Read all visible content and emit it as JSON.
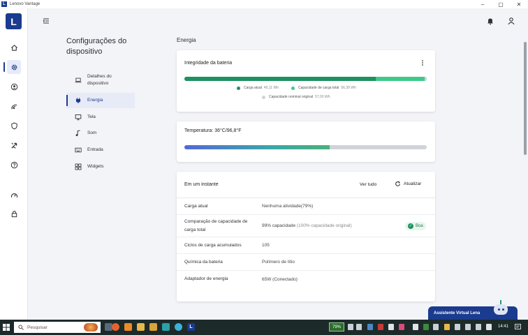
{
  "window": {
    "title": "Lenovo Vantage",
    "logo_letter": "L",
    "controls": [
      "–",
      "▢",
      "✕"
    ]
  },
  "sidebar_nav": {
    "title": "Configurações do dispositivo",
    "items": [
      {
        "label": "Detalhes do dispositivo",
        "icon": "laptop-icon",
        "active": false
      },
      {
        "label": "Energia",
        "icon": "plug-icon",
        "active": true
      },
      {
        "label": "Tela",
        "icon": "monitor-icon",
        "active": false
      },
      {
        "label": "Som",
        "icon": "music-note-icon",
        "active": false
      },
      {
        "label": "Entrada",
        "icon": "keyboard-icon",
        "active": false
      },
      {
        "label": "Widgets",
        "icon": "widgets-icon",
        "active": false
      }
    ]
  },
  "section_title": "Energia",
  "battery_health": {
    "title": "Integridade da bateria",
    "current_fraction": 0.79,
    "full_fraction": 0.99,
    "legend": [
      {
        "label": "Carga atual",
        "value": "45,11 Wh",
        "color": "#1e9160"
      },
      {
        "label": "Capacidade de carga total",
        "value": "56,39 Wh",
        "color": "#3ec98a"
      },
      {
        "label": "Capacidade nominal original",
        "value": "57,00 Wh",
        "color": "#cfd3da"
      }
    ]
  },
  "temperature": {
    "label": "Temperatura:",
    "value": "36°C/96,8°F",
    "fraction": 0.6
  },
  "overview": {
    "title": "Em um instante",
    "see_all": "Ver tudo",
    "refresh": "Atualizar",
    "rows": [
      {
        "key": "Carga atual",
        "value": "Nenhuma atividade(79%)",
        "sub": ""
      },
      {
        "key": "Comparação de capacidade de carga total",
        "value": "99% capacidade",
        "sub": " (100% capacidade original)",
        "badge": "Boa"
      },
      {
        "key": "Ciclos de carga acumulados",
        "value": "105",
        "sub": ""
      },
      {
        "key": "Química da bateria",
        "value": "Polímero de lítio",
        "sub": ""
      },
      {
        "key": "Adaptador de energia",
        "value": "65W (Conectado)",
        "sub": ""
      }
    ]
  },
  "assistant": {
    "label": "Assistente Virtual Lena"
  },
  "taskbar": {
    "search_placeholder": "Pesquisar",
    "battery_percent": "79%",
    "clock": "14:41"
  },
  "colors": {
    "brand": "#1b3b8f",
    "good": "#1e9160",
    "accent_green": "#3ec98a"
  }
}
